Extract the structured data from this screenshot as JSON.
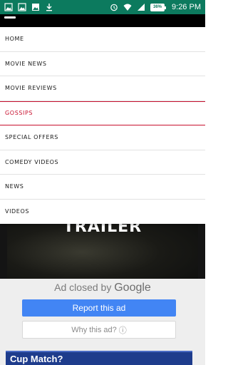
{
  "status_bar": {
    "time": "9:26",
    "time_suffix": "PM",
    "battery": "36%",
    "left_icons": [
      "image-icon",
      "image-icon",
      "image-icon",
      "download-icon"
    ],
    "right_icons": [
      "alarm-icon",
      "wifi-icon",
      "signal-icon"
    ]
  },
  "nav": {
    "items": [
      {
        "label": "HOME"
      },
      {
        "label": "MOVIE NEWS"
      },
      {
        "label": "MOVIE REVIEWS"
      },
      {
        "label": "GOSSIPS"
      },
      {
        "label": "SPECIAL OFFERS"
      },
      {
        "label": "COMEDY VIDEOS"
      },
      {
        "label": "NEWS"
      },
      {
        "label": "VIDEOS"
      }
    ],
    "active_index": 3
  },
  "video": {
    "title": "TRAILER"
  },
  "ad": {
    "closed_text": "Ad closed by",
    "brand": "Google",
    "report_label": "Report this ad",
    "why_label": "Why this ad?",
    "info_glyph": "ⓘ"
  },
  "banner": {
    "text": "Cup Match?"
  },
  "colors": {
    "status_bar": "#0c7a5e",
    "active_item": "#c8102e",
    "report_button": "#4285f4",
    "banner": "#1e3c8c"
  }
}
